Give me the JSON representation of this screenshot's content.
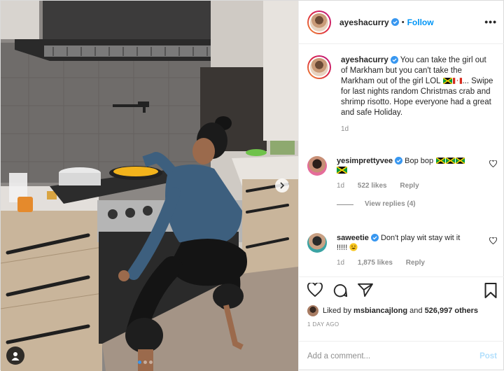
{
  "header": {
    "username": "ayeshacurry",
    "separator": "•",
    "follow_label": "Follow",
    "more_label": "•••"
  },
  "caption": {
    "username": "ayeshacurry",
    "text_a": "You can take the girl out of Markham but you can't take the Markham out of the girl LOL",
    "text_b": "... Swipe for last nights random Christmas crab and shrimp risotto. Hope everyone had a great and safe Holiday.",
    "flags": [
      "jamaica-flag",
      "canada-flag"
    ],
    "time": "1d"
  },
  "comments": [
    {
      "username": "yesimprettyvee",
      "text": "Bop bop",
      "flags": [
        "jamaica-flag",
        "jamaica-flag",
        "jamaica-flag",
        "jamaica-flag"
      ],
      "time": "1d",
      "likes": "522 likes",
      "reply_label": "Reply",
      "view_replies": "View replies (4)"
    },
    {
      "username": "saweetie",
      "text": "Don't play wit stay wit it",
      "text_tail": "!!!!!",
      "emoji": "grinning-face-emoji",
      "time": "1d",
      "likes": "1,875 likes",
      "reply_label": "Reply"
    }
  ],
  "actions": {
    "like_icon": "heart-icon",
    "comment_icon": "comment-icon",
    "share_icon": "paper-plane-icon",
    "save_icon": "bookmark-icon"
  },
  "likes": {
    "prefix": "Liked by",
    "user": "msbiancajlong",
    "joiner": "and",
    "others": "526,997 others"
  },
  "time_ago": "1 DAY AGO",
  "add_comment": {
    "placeholder": "Add a comment...",
    "post_label": "Post"
  },
  "carousel": {
    "slide_count": 3,
    "active_slide": 1
  },
  "colors": {
    "accent": "#0095f6",
    "post_disabled": "#b2dffc",
    "muted": "#8e8e8e",
    "text": "#262626"
  }
}
